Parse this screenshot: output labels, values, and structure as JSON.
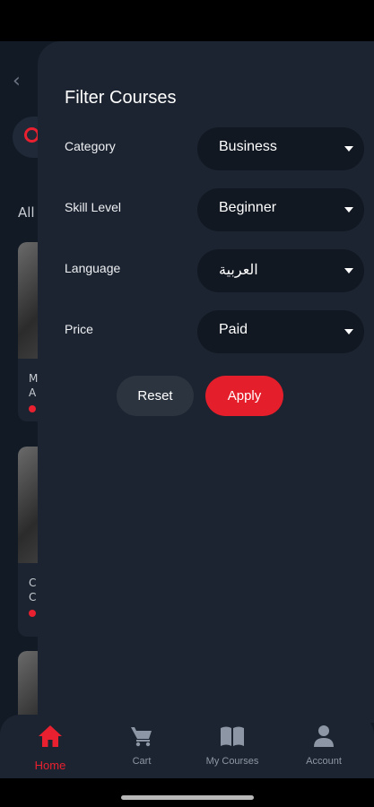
{
  "background": {
    "all_label": "All",
    "card1_text": "M\nA",
    "card2_text": "C\nC"
  },
  "filter": {
    "title": "Filter Courses",
    "rows": [
      {
        "label": "Category",
        "value": "Business"
      },
      {
        "label": "Skill Level",
        "value": "Beginner"
      },
      {
        "label": "Language",
        "value": "العربية"
      },
      {
        "label": "Price",
        "value": "Paid"
      }
    ],
    "reset_label": "Reset",
    "apply_label": "Apply"
  },
  "nav": {
    "items": [
      {
        "label": "Home",
        "icon": "home-icon",
        "active": true
      },
      {
        "label": "Cart",
        "icon": "cart-icon",
        "active": false
      },
      {
        "label": "My Courses",
        "icon": "book-icon",
        "active": false
      },
      {
        "label": "Account",
        "icon": "user-icon",
        "active": false
      }
    ]
  },
  "colors": {
    "accent": "#e51e2b",
    "panel": "#1c2431",
    "select_bg": "#111822"
  }
}
